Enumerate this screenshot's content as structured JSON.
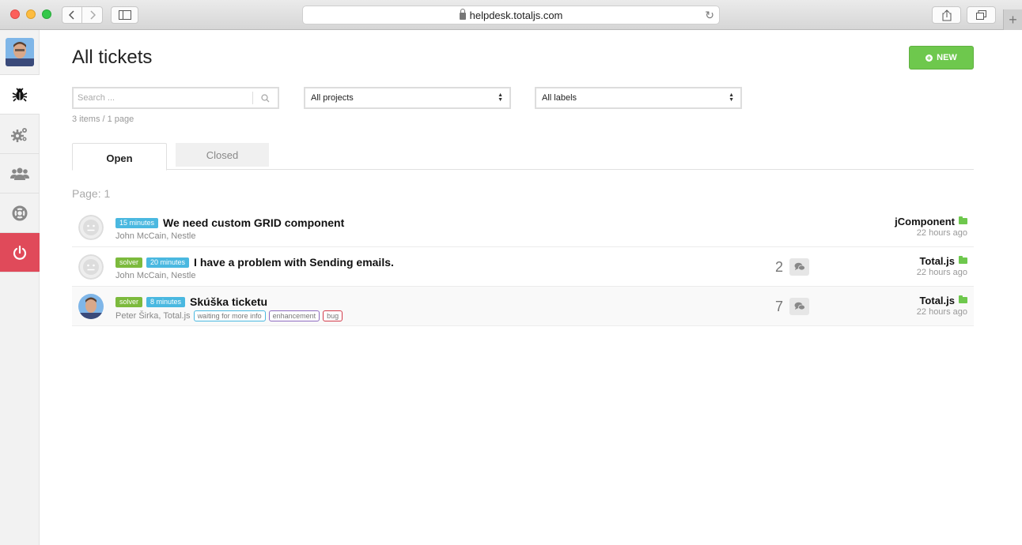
{
  "browser": {
    "url": "helpdesk.totaljs.com"
  },
  "colors": {
    "accent_green": "#6ec84d",
    "logout_red": "#e04a5a",
    "time_badge": "#4ab8e0",
    "solver_badge": "#7cba3d"
  },
  "sidebar": {
    "items": [
      {
        "icon": "bug-icon"
      },
      {
        "icon": "gears-icon"
      },
      {
        "icon": "users-icon"
      },
      {
        "icon": "lifebuoy-icon"
      },
      {
        "icon": "power-icon"
      }
    ]
  },
  "page": {
    "title": "All tickets",
    "new_button": "NEW",
    "search_placeholder": "Search ...",
    "projects_select": "All projects",
    "labels_select": "All labels",
    "meta": "3 items / 1 page",
    "tabs": [
      "Open",
      "Closed"
    ],
    "page_label": "Page: 1"
  },
  "tickets": [
    {
      "time": "15 minutes",
      "solver": "",
      "title": "We need custom GRID component",
      "author": "John McCain, Nestle",
      "comments": "",
      "project": "jComponent",
      "ago": "22 hours ago",
      "labels": []
    },
    {
      "time": "20 minutes",
      "solver": "solver",
      "title": "I have a problem with Sending emails.",
      "author": "John McCain, Nestle",
      "comments": "2",
      "project": "Total.js",
      "ago": "22 hours ago",
      "labels": []
    },
    {
      "time": "8 minutes",
      "solver": "solver",
      "title": "Skúška ticketu",
      "author": "Peter Širka, Total.js",
      "comments": "7",
      "project": "Total.js",
      "ago": "22 hours ago",
      "labels": [
        "waiting for more info",
        "enhancement",
        "bug"
      ]
    }
  ]
}
